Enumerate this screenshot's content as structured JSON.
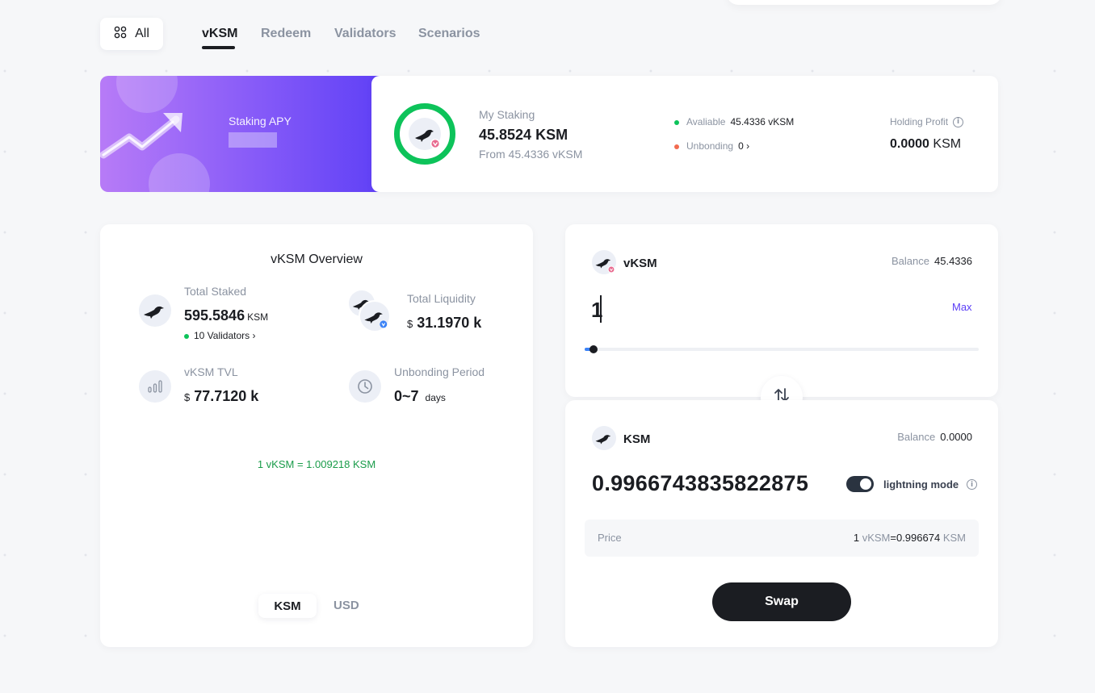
{
  "nav": {
    "all_label": "All",
    "tabs": [
      {
        "label": "vKSM",
        "active": true
      },
      {
        "label": "Redeem"
      },
      {
        "label": "Validators"
      },
      {
        "label": "Scenarios"
      }
    ]
  },
  "banner": {
    "title": "Staking APY"
  },
  "staking": {
    "title": "My Staking",
    "value": "45.8524 KSM",
    "from": "From 45.4336 vKSM",
    "available_label": "Avaliable",
    "available_value": "45.4336 vKSM",
    "unbonding_label": "Unbonding",
    "unbonding_value": "0 ›",
    "holding_profit_label": "Holding Profit",
    "holding_profit_value": "0.0000",
    "holding_profit_unit": "KSM",
    "ring_color": "#0dc35a"
  },
  "overview": {
    "title": "vKSM Overview",
    "total_staked_label": "Total Staked",
    "total_staked_value": "595.5846",
    "total_staked_unit": "KSM",
    "validators_link": "10 Validators ›",
    "total_liquidity_label": "Total Liquidity",
    "total_liquidity_currency": "$",
    "total_liquidity_value": "31.1970 k",
    "tvl_label": "vKSM TVL",
    "tvl_currency": "$",
    "tvl_value": "77.7120 k",
    "unbonding_period_label": "Unbonding Period",
    "unbonding_period_value": "0~7",
    "unbonding_period_unit": "days",
    "rate": "1 vKSM = 1.009218 KSM",
    "unit_options": [
      "KSM",
      "USD"
    ],
    "selected_unit": "KSM"
  },
  "swap": {
    "from": {
      "token": "vKSM",
      "balance_label": "Balance",
      "balance_value": "45.4336",
      "amount": "1",
      "max_label": "Max",
      "slider_percent": 2
    },
    "to": {
      "token": "KSM",
      "balance_label": "Balance",
      "balance_value": "0.0000",
      "amount": "0.9966743835822875",
      "lightning_mode_label": "lightning mode",
      "lightning_mode_on": true
    },
    "price_label": "Price",
    "price_left": "1",
    "price_left_unit": "vKSM",
    "price_equals": "=",
    "price_right": "0.996674",
    "price_right_unit": "KSM",
    "button_label": "Swap"
  },
  "colors": {
    "accent": "#5a3df6",
    "success": "#0dc35a",
    "warning": "#f26b4f",
    "dark": "#1b1d22"
  }
}
